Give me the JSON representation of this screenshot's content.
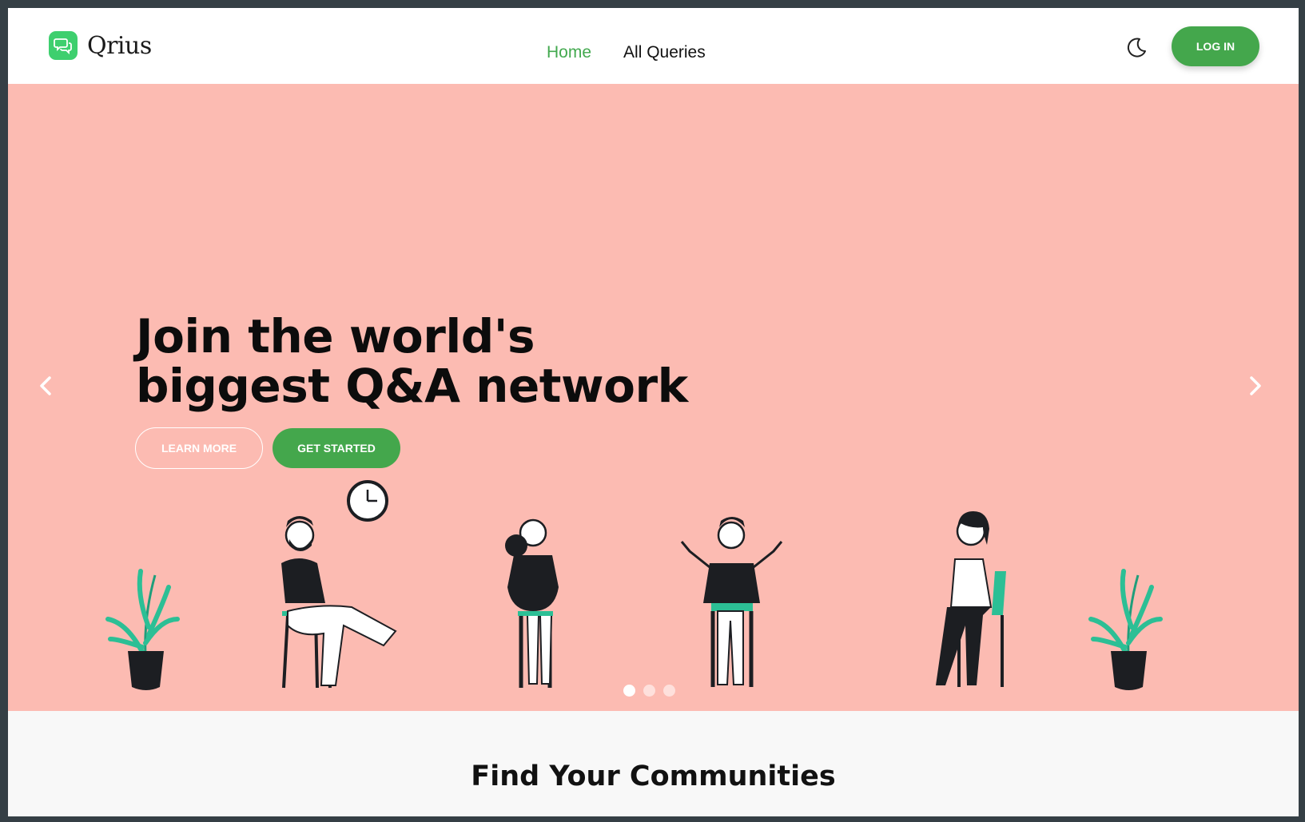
{
  "brand": {
    "name": "Qrius",
    "icon": "chat-bubbles-icon",
    "color": "#3ecf6e"
  },
  "nav": {
    "items": [
      {
        "label": "Home",
        "active": true
      },
      {
        "label": "All Queries",
        "active": false
      }
    ]
  },
  "header": {
    "theme_toggle_icon": "moon-icon",
    "login_label": "LOG IN"
  },
  "hero": {
    "title_line1": "Join the world's",
    "title_line2": "biggest Q&A network",
    "learn_more_label": "LEARN MORE",
    "get_started_label": "GET STARTED",
    "background": "#fcbbb2",
    "accent": "#44a74c",
    "slides": 3,
    "active_slide": 1
  },
  "communities": {
    "title": "Find Your Communities"
  }
}
